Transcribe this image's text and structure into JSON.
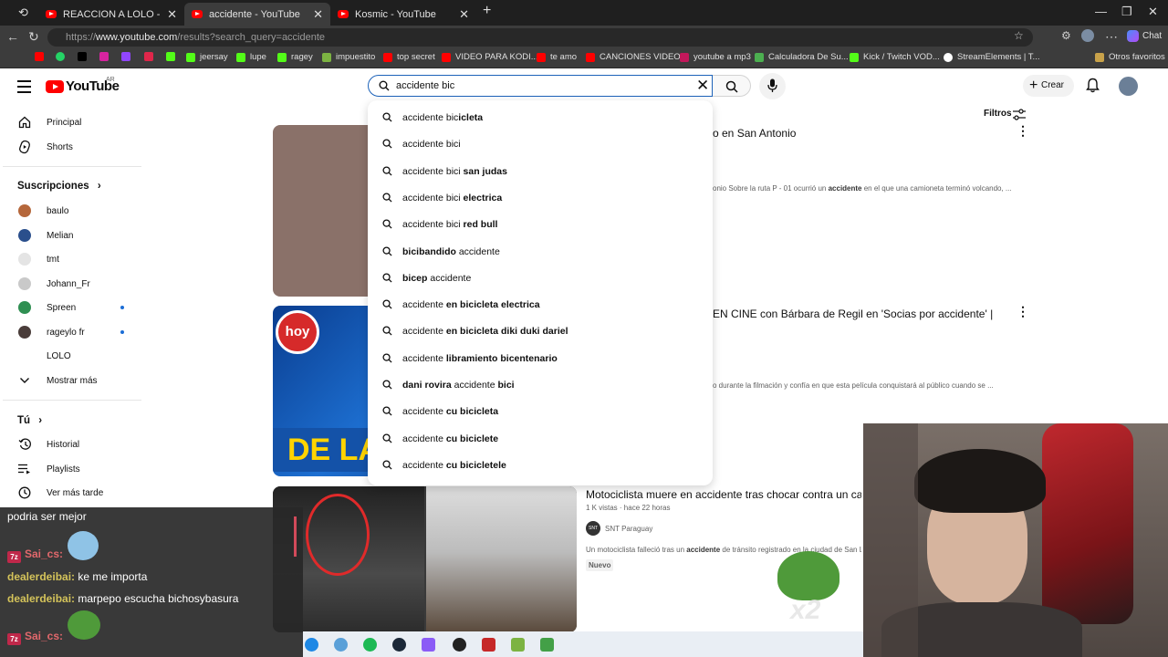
{
  "browser": {
    "tabs": [
      {
        "title": "REACCION A LOLO - EMILIA MERI",
        "active": false
      },
      {
        "title": "accidente - YouTube",
        "active": true
      },
      {
        "title": "Kosmic - YouTube",
        "active": false
      }
    ],
    "url_prefix": "https://",
    "url_host": "www.youtube.com",
    "url_path": "/results?search_query=accidente",
    "bookmarks": [
      "jeersay",
      "lupe",
      "ragey",
      "impuestito",
      "top secret",
      "VIDEO PARA KODI...",
      "te amo",
      "CANCIONES VIDEOS",
      "youtube a mp3",
      "Calculadora De Su...",
      "Kick / Twitch VOD...",
      "StreamElements | T...",
      "Otros favoritos"
    ],
    "chat_label": "Chat"
  },
  "header": {
    "logo": "YouTube",
    "country": "AR",
    "search_value": "accidente bic",
    "create_label": "Crear"
  },
  "sidebar": {
    "main": [
      {
        "label": "Principal",
        "icon": "home-icon"
      },
      {
        "label": "Shorts",
        "icon": "shorts-icon"
      }
    ],
    "subscriptions_title": "Suscripciones",
    "subscriptions": [
      {
        "label": "baulo",
        "color": "#b5673b",
        "live": false
      },
      {
        "label": "Melian",
        "color": "#2a4f8c",
        "live": false
      },
      {
        "label": "tmt",
        "color": "#e4e4e4",
        "live": false
      },
      {
        "label": "Johann_Fr",
        "color": "#c9c9c9",
        "live": false
      },
      {
        "label": "Spreen",
        "color": "#2f8f52",
        "live": true
      },
      {
        "label": "rageylo fr",
        "color": "#4a3d3a",
        "live": true
      },
      {
        "label": "LOLO",
        "color": "#ffffff",
        "live": false
      },
      {
        "label": "Mostrar más",
        "icon": "chevron-down-icon"
      }
    ],
    "you_title": "Tú",
    "you": [
      {
        "label": "Historial",
        "icon": "history-icon"
      },
      {
        "label": "Playlists",
        "icon": "playlists-icon"
      },
      {
        "label": "Ver más tarde",
        "icon": "watch-later-icon"
      }
    ]
  },
  "filters_label": "Filtros",
  "suggestions": [
    {
      "prefix": "accidente bic",
      "bold": "icleta",
      "suffix": ""
    },
    {
      "prefix": "accidente bici",
      "bold": "",
      "suffix": ""
    },
    {
      "prefix": "accidente bici ",
      "bold": "san judas",
      "suffix": ""
    },
    {
      "prefix": "accidente bici ",
      "bold": "electrica",
      "suffix": ""
    },
    {
      "prefix": "accidente bici ",
      "bold": "red bull",
      "suffix": ""
    },
    {
      "prefix": "",
      "bold": "bicibandido",
      "suffix": " accidente"
    },
    {
      "prefix": "",
      "bold": "bicep",
      "suffix": " accidente"
    },
    {
      "prefix": "accidente ",
      "bold": "en bicicleta electrica",
      "suffix": ""
    },
    {
      "prefix": "accidente ",
      "bold": "en bicicleta diki duki dariel",
      "suffix": ""
    },
    {
      "prefix": "accidente ",
      "bold": "libramiento bicentenario",
      "suffix": ""
    },
    {
      "prefix": "",
      "bold": "dani rovira",
      "suffix": " accidente ",
      "bold2": "bici"
    },
    {
      "prefix": "accidente ",
      "bold": "cu bicicleta",
      "suffix": ""
    },
    {
      "prefix": "accidente ",
      "bold": "cu biciclete",
      "suffix": ""
    },
    {
      "prefix": "accidente ",
      "bold": "cu bicicletele",
      "suffix": ""
    }
  ],
  "results": [
    {
      "title": "o en San Antonio",
      "desc_pre": "onio Sobre la ruta P - 01 ocurrió un ",
      "desc_bold": "accidente",
      "desc_post": " en el que una camioneta terminó volcando, ..."
    },
    {
      "title": "EN CINE con Bárbara de Regil en 'Socias por accidente' |",
      "desc_pre": "o durante la filmación y confía en que esta película conquistará al público cuando se ...",
      "desc_bold": "",
      "desc_post": ""
    },
    {
      "title": "Motociclista muere en accidente tras chocar contra un ca",
      "views": "1 K vistas · hace 22 horas",
      "channel": "SNT Paraguay",
      "channel_badge": "SNT",
      "desc_pre": "Un motociclista falleció tras un ",
      "desc_bold": "accidente",
      "desc_post": " de tránsito registrado en la ciudad de San L",
      "new_badge": "Nuevo"
    }
  ],
  "thumb_overlay_text": "DE LA",
  "thumb_logo": "hoy",
  "chat": [
    {
      "user": "",
      "text": "podria ser mejor"
    },
    {
      "user": "Sai_cs:",
      "text": "",
      "badge": "7z"
    },
    {
      "user": "dealerdeibai:",
      "text": "ke me importa"
    },
    {
      "user": "dealerdeibai:",
      "text": "marpepo escucha bichosybasura"
    },
    {
      "user": "Sai_cs:",
      "text": "",
      "badge": "7z"
    }
  ],
  "emote_text": "x2"
}
